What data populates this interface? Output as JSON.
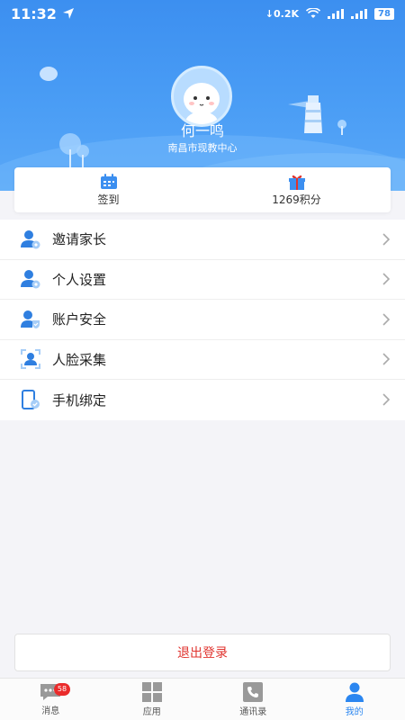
{
  "status_bar": {
    "time": "11:32",
    "net_speed": "0.2K",
    "battery": "78"
  },
  "profile": {
    "name": "何一鸣",
    "organization": "南昌市现教中心"
  },
  "stats": [
    {
      "label": "签到",
      "icon": "calendar-icon"
    },
    {
      "label": "1269积分",
      "icon": "gift-icon"
    }
  ],
  "menu": [
    {
      "label": "邀请家长",
      "icon": "invite-parent-icon"
    },
    {
      "label": "个人设置",
      "icon": "user-settings-icon"
    },
    {
      "label": "账户安全",
      "icon": "account-security-icon"
    },
    {
      "label": "人脸采集",
      "icon": "face-scan-icon"
    },
    {
      "label": "手机绑定",
      "icon": "phone-bind-icon"
    }
  ],
  "logout_label": "退出登录",
  "tabbar": [
    {
      "label": "消息",
      "icon": "message-icon",
      "badge": "58"
    },
    {
      "label": "应用",
      "icon": "apps-grid-icon"
    },
    {
      "label": "通讯录",
      "icon": "contacts-phone-icon"
    },
    {
      "label": "我的",
      "icon": "profile-icon",
      "active": true
    }
  ],
  "colors": {
    "primary": "#3c8ff0",
    "danger": "#e0332e",
    "active_tab": "#2b86f0"
  }
}
